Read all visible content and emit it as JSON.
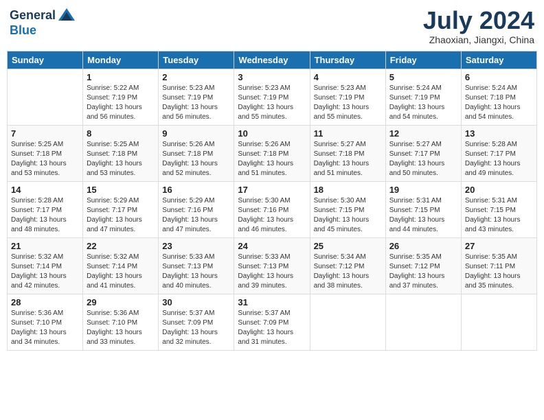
{
  "logo": {
    "general": "General",
    "blue": "Blue"
  },
  "title": {
    "month_year": "July 2024",
    "location": "Zhaoxian, Jiangxi, China"
  },
  "weekdays": [
    "Sunday",
    "Monday",
    "Tuesday",
    "Wednesday",
    "Thursday",
    "Friday",
    "Saturday"
  ],
  "weeks": [
    [
      {
        "day": "",
        "sunrise": "",
        "sunset": "",
        "daylight": ""
      },
      {
        "day": "1",
        "sunrise": "Sunrise: 5:22 AM",
        "sunset": "Sunset: 7:19 PM",
        "daylight": "Daylight: 13 hours and 56 minutes."
      },
      {
        "day": "2",
        "sunrise": "Sunrise: 5:23 AM",
        "sunset": "Sunset: 7:19 PM",
        "daylight": "Daylight: 13 hours and 56 minutes."
      },
      {
        "day": "3",
        "sunrise": "Sunrise: 5:23 AM",
        "sunset": "Sunset: 7:19 PM",
        "daylight": "Daylight: 13 hours and 55 minutes."
      },
      {
        "day": "4",
        "sunrise": "Sunrise: 5:23 AM",
        "sunset": "Sunset: 7:19 PM",
        "daylight": "Daylight: 13 hours and 55 minutes."
      },
      {
        "day": "5",
        "sunrise": "Sunrise: 5:24 AM",
        "sunset": "Sunset: 7:19 PM",
        "daylight": "Daylight: 13 hours and 54 minutes."
      },
      {
        "day": "6",
        "sunrise": "Sunrise: 5:24 AM",
        "sunset": "Sunset: 7:18 PM",
        "daylight": "Daylight: 13 hours and 54 minutes."
      }
    ],
    [
      {
        "day": "7",
        "sunrise": "Sunrise: 5:25 AM",
        "sunset": "Sunset: 7:18 PM",
        "daylight": "Daylight: 13 hours and 53 minutes."
      },
      {
        "day": "8",
        "sunrise": "Sunrise: 5:25 AM",
        "sunset": "Sunset: 7:18 PM",
        "daylight": "Daylight: 13 hours and 53 minutes."
      },
      {
        "day": "9",
        "sunrise": "Sunrise: 5:26 AM",
        "sunset": "Sunset: 7:18 PM",
        "daylight": "Daylight: 13 hours and 52 minutes."
      },
      {
        "day": "10",
        "sunrise": "Sunrise: 5:26 AM",
        "sunset": "Sunset: 7:18 PM",
        "daylight": "Daylight: 13 hours and 51 minutes."
      },
      {
        "day": "11",
        "sunrise": "Sunrise: 5:27 AM",
        "sunset": "Sunset: 7:18 PM",
        "daylight": "Daylight: 13 hours and 51 minutes."
      },
      {
        "day": "12",
        "sunrise": "Sunrise: 5:27 AM",
        "sunset": "Sunset: 7:17 PM",
        "daylight": "Daylight: 13 hours and 50 minutes."
      },
      {
        "day": "13",
        "sunrise": "Sunrise: 5:28 AM",
        "sunset": "Sunset: 7:17 PM",
        "daylight": "Daylight: 13 hours and 49 minutes."
      }
    ],
    [
      {
        "day": "14",
        "sunrise": "Sunrise: 5:28 AM",
        "sunset": "Sunset: 7:17 PM",
        "daylight": "Daylight: 13 hours and 48 minutes."
      },
      {
        "day": "15",
        "sunrise": "Sunrise: 5:29 AM",
        "sunset": "Sunset: 7:17 PM",
        "daylight": "Daylight: 13 hours and 47 minutes."
      },
      {
        "day": "16",
        "sunrise": "Sunrise: 5:29 AM",
        "sunset": "Sunset: 7:16 PM",
        "daylight": "Daylight: 13 hours and 47 minutes."
      },
      {
        "day": "17",
        "sunrise": "Sunrise: 5:30 AM",
        "sunset": "Sunset: 7:16 PM",
        "daylight": "Daylight: 13 hours and 46 minutes."
      },
      {
        "day": "18",
        "sunrise": "Sunrise: 5:30 AM",
        "sunset": "Sunset: 7:15 PM",
        "daylight": "Daylight: 13 hours and 45 minutes."
      },
      {
        "day": "19",
        "sunrise": "Sunrise: 5:31 AM",
        "sunset": "Sunset: 7:15 PM",
        "daylight": "Daylight: 13 hours and 44 minutes."
      },
      {
        "day": "20",
        "sunrise": "Sunrise: 5:31 AM",
        "sunset": "Sunset: 7:15 PM",
        "daylight": "Daylight: 13 hours and 43 minutes."
      }
    ],
    [
      {
        "day": "21",
        "sunrise": "Sunrise: 5:32 AM",
        "sunset": "Sunset: 7:14 PM",
        "daylight": "Daylight: 13 hours and 42 minutes."
      },
      {
        "day": "22",
        "sunrise": "Sunrise: 5:32 AM",
        "sunset": "Sunset: 7:14 PM",
        "daylight": "Daylight: 13 hours and 41 minutes."
      },
      {
        "day": "23",
        "sunrise": "Sunrise: 5:33 AM",
        "sunset": "Sunset: 7:13 PM",
        "daylight": "Daylight: 13 hours and 40 minutes."
      },
      {
        "day": "24",
        "sunrise": "Sunrise: 5:33 AM",
        "sunset": "Sunset: 7:13 PM",
        "daylight": "Daylight: 13 hours and 39 minutes."
      },
      {
        "day": "25",
        "sunrise": "Sunrise: 5:34 AM",
        "sunset": "Sunset: 7:12 PM",
        "daylight": "Daylight: 13 hours and 38 minutes."
      },
      {
        "day": "26",
        "sunrise": "Sunrise: 5:35 AM",
        "sunset": "Sunset: 7:12 PM",
        "daylight": "Daylight: 13 hours and 37 minutes."
      },
      {
        "day": "27",
        "sunrise": "Sunrise: 5:35 AM",
        "sunset": "Sunset: 7:11 PM",
        "daylight": "Daylight: 13 hours and 35 minutes."
      }
    ],
    [
      {
        "day": "28",
        "sunrise": "Sunrise: 5:36 AM",
        "sunset": "Sunset: 7:10 PM",
        "daylight": "Daylight: 13 hours and 34 minutes."
      },
      {
        "day": "29",
        "sunrise": "Sunrise: 5:36 AM",
        "sunset": "Sunset: 7:10 PM",
        "daylight": "Daylight: 13 hours and 33 minutes."
      },
      {
        "day": "30",
        "sunrise": "Sunrise: 5:37 AM",
        "sunset": "Sunset: 7:09 PM",
        "daylight": "Daylight: 13 hours and 32 minutes."
      },
      {
        "day": "31",
        "sunrise": "Sunrise: 5:37 AM",
        "sunset": "Sunset: 7:09 PM",
        "daylight": "Daylight: 13 hours and 31 minutes."
      },
      {
        "day": "",
        "sunrise": "",
        "sunset": "",
        "daylight": ""
      },
      {
        "day": "",
        "sunrise": "",
        "sunset": "",
        "daylight": ""
      },
      {
        "day": "",
        "sunrise": "",
        "sunset": "",
        "daylight": ""
      }
    ]
  ]
}
